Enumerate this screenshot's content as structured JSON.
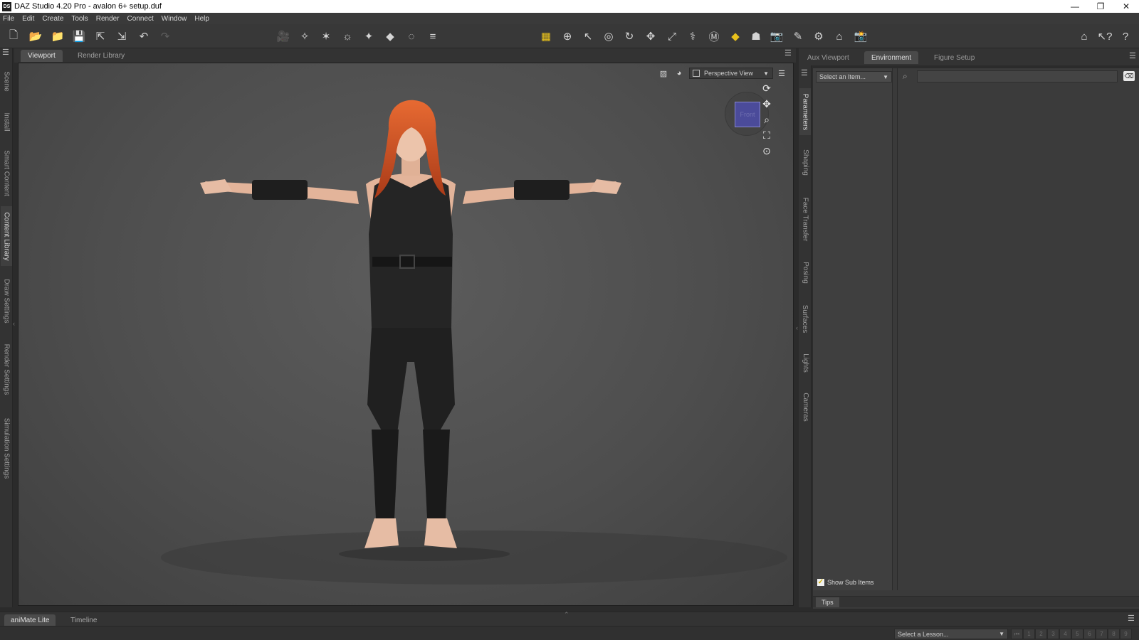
{
  "window": {
    "title": "DAZ Studio 4.20 Pro - avalon 6+ setup.duf",
    "app_icon_text": "DS",
    "minimize": "—",
    "restore": "❐",
    "close": "✕"
  },
  "menu": [
    "File",
    "Edit",
    "Create",
    "Tools",
    "Render",
    "Connect",
    "Window",
    "Help"
  ],
  "left_panes": [
    "Scene",
    "Install",
    "Smart Content",
    "Content Library",
    "Draw Settings",
    "Render Settings",
    "Simulation Settings"
  ],
  "left_active": "Content Library",
  "viewport_tabs": [
    "Viewport",
    "Render Library"
  ],
  "viewport": {
    "camera": "Perspective View",
    "cube_label": "Front"
  },
  "right_tabs": [
    "Aux Viewport",
    "Environment",
    "Figure Setup"
  ],
  "right_sidebar_tabs": [
    "Parameters",
    "Shaping",
    "Face Transfer",
    "Posing",
    "Surfaces",
    "Lights",
    "Cameras"
  ],
  "parameters": {
    "select_placeholder": "Select an Item...",
    "show_sub_items": "Show Sub Items",
    "search_placeholder": ""
  },
  "tips_label": "Tips",
  "bottom_tabs": [
    "aniMate Lite",
    "Timeline"
  ],
  "status": {
    "lesson_placeholder": "Select a Lesson...",
    "steps": [
      "⏮",
      "1",
      "2",
      "3",
      "4",
      "5",
      "6",
      "7",
      "8",
      "9"
    ]
  },
  "colors": {
    "accent_yellow": "#e8c11c",
    "bg_dark": "#2b2b2b",
    "viewport_bg": "#555555",
    "hair": "#d2572a",
    "skin": "#e9bfa8",
    "outfit": "#242424"
  }
}
